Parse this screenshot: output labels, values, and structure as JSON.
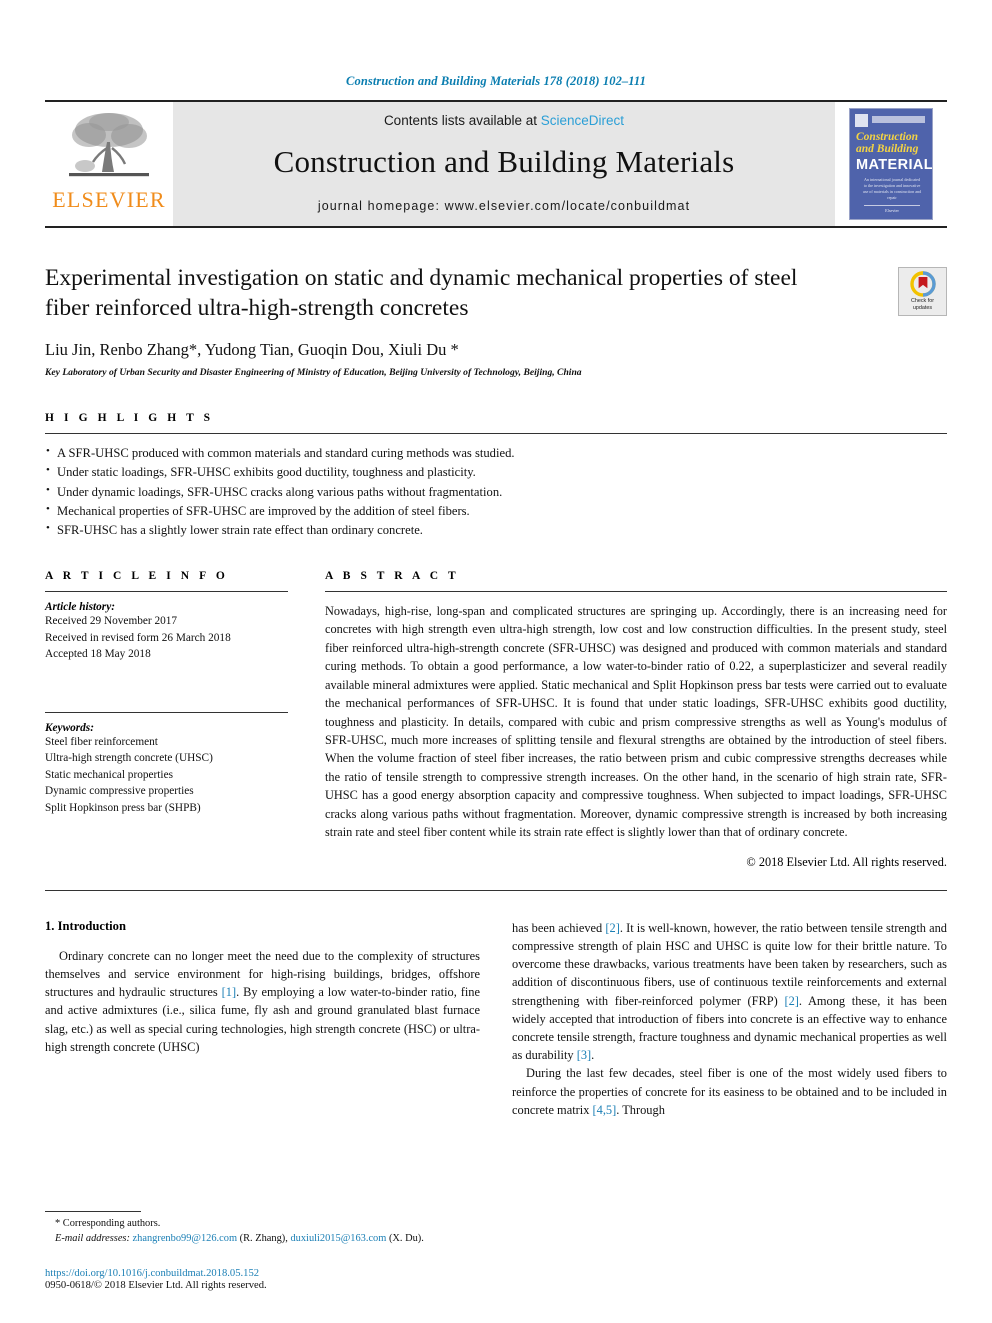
{
  "running_head": "Construction and Building Materials 178 (2018) 102–111",
  "masthead": {
    "publisher_name": "ELSEVIER",
    "contents_prefix": "Contents lists available at ",
    "contents_link": "ScienceDirect",
    "journal_title": "Construction and Building Materials",
    "homepage": "journal homepage: www.elsevier.com/locate/conbuildmat",
    "cover": {
      "line1": "Construction",
      "line2": "and Building",
      "line3": "MATERIALS",
      "blurb": "An international journal dedicated to the investigation and innovative use of materials in construction and repair",
      "foot": "Elsevier"
    }
  },
  "article": {
    "title": "Experimental investigation on static and dynamic mechanical properties of steel fiber reinforced ultra-high-strength concretes",
    "authors": "Liu Jin, Renbo Zhang*, Yudong Tian, Guoqin Dou, Xiuli Du *",
    "affiliation": "Key Laboratory of Urban Security and Disaster Engineering of Ministry of Education, Beijing University of Technology, Beijing, China",
    "crossmark_line1": "Check for",
    "crossmark_line2": "updates"
  },
  "highlights": {
    "label": "H I G H L I G H T S",
    "items": [
      "A SFR-UHSC produced with common materials and standard curing methods was studied.",
      "Under static loadings, SFR-UHSC exhibits good ductility, toughness and plasticity.",
      "Under dynamic loadings, SFR-UHSC cracks along various paths without fragmentation.",
      "Mechanical properties of SFR-UHSC are improved by the addition of steel fibers.",
      "SFR-UHSC has a slightly lower strain rate effect than ordinary concrete."
    ]
  },
  "article_info": {
    "label": "A R T I C L E   I N F O",
    "history_heading": "Article history:",
    "history": [
      "Received 29 November 2017",
      "Received in revised form 26 March 2018",
      "Accepted 18 May 2018"
    ],
    "keywords_heading": "Keywords:",
    "keywords": [
      "Steel fiber reinforcement",
      "Ultra-high strength concrete (UHSC)",
      "Static mechanical properties",
      "Dynamic compressive properties",
      "Split Hopkinson press bar (SHPB)"
    ]
  },
  "abstract": {
    "label": "A B S T R A C T",
    "text": "Nowadays, high-rise, long-span and complicated structures are springing up. Accordingly, there is an increasing need for concretes with high strength even ultra-high strength, low cost and low construction difficulties. In the present study, steel fiber reinforced ultra-high-strength concrete (SFR-UHSC) was designed and produced with common materials and standard curing methods. To obtain a good performance, a low water-to-binder ratio of 0.22, a superplasticizer and several readily available mineral admixtures were applied. Static mechanical and Split Hopkinson press bar tests were carried out to evaluate the mechanical performances of SFR-UHSC. It is found that under static loadings, SFR-UHSC exhibits good ductility, toughness and plasticity. In details, compared with cubic and prism compressive strengths as well as Young's modulus of SFR-UHSC, much more increases of splitting tensile and flexural strengths are obtained by the introduction of steel fibers. When the volume fraction of steel fiber increases, the ratio between prism and cubic compressive strengths decreases while the ratio of tensile strength to compressive strength increases. On the other hand, in the scenario of high strain rate, SFR-UHSC has a good energy absorption capacity and compressive toughness. When subjected to impact loadings, SFR-UHSC cracks along various paths without fragmentation. Moreover, dynamic compressive strength is increased by both increasing strain rate and steel fiber content while its strain rate effect is slightly lower than that of ordinary concrete.",
    "copyright": "© 2018 Elsevier Ltd. All rights reserved."
  },
  "body": {
    "section_title": "1. Introduction",
    "left_paragraph_1": "Ordinary concrete can no longer meet the need due to the complexity of structures themselves and service environment for high-rising buildings, bridges, offshore structures and hydraulic structures ",
    "left_ref_1": "[1]",
    "left_paragraph_1b": ". By employing a low water-to-binder ratio, fine and active admixtures (i.e., silica fume, fly ash and ground granulated blast furnace slag, etc.) as well as special curing technologies, high strength concrete (HSC) or ultra-high strength concrete (UHSC)",
    "right_paragraph_1a": "has been achieved ",
    "right_ref_1": "[2]",
    "right_paragraph_1b": ". It is well-known, however, the ratio between tensile strength and compressive strength of plain HSC and UHSC is quite low for their brittle nature. To overcome these drawbacks, various treatments have been taken by researchers, such as addition of discontinuous fibers, use of continuous textile reinforcements and external strengthening with fiber-reinforced polymer (FRP) ",
    "right_ref_2": "[2]",
    "right_paragraph_1c": ". Among these, it has been widely accepted that introduction of fibers into concrete is an effective way to enhance concrete tensile strength, fracture toughness and dynamic mechanical properties as well as durability ",
    "right_ref_3": "[3]",
    "right_paragraph_1d": ".",
    "right_paragraph_2a": "During the last few decades, steel fiber is one of the most widely used fibers to reinforce the properties of concrete for its easiness to be obtained and to be included in concrete matrix ",
    "right_ref_4": "[4,5]",
    "right_paragraph_2b": ". Through"
  },
  "footnote": {
    "corresponding": "* Corresponding authors.",
    "email_label": "E-mail addresses:",
    "email_1": "zhangrenbo99@126.com",
    "email_1_author": "(R. Zhang),",
    "email_2": "duxiuli2015@163.com",
    "email_2_author": "(X. Du).",
    "doi": "https://doi.org/10.1016/j.conbuildmat.2018.05.152",
    "issn": "0950-0618/© 2018 Elsevier Ltd. All rights reserved."
  },
  "colors": {
    "link": "#1b7fb5",
    "sciencedirect": "#2b9fd6",
    "elsevier_orange": "#f08c1b",
    "cover_blue": "#4f63ab",
    "cover_yellow": "#f5d442"
  }
}
